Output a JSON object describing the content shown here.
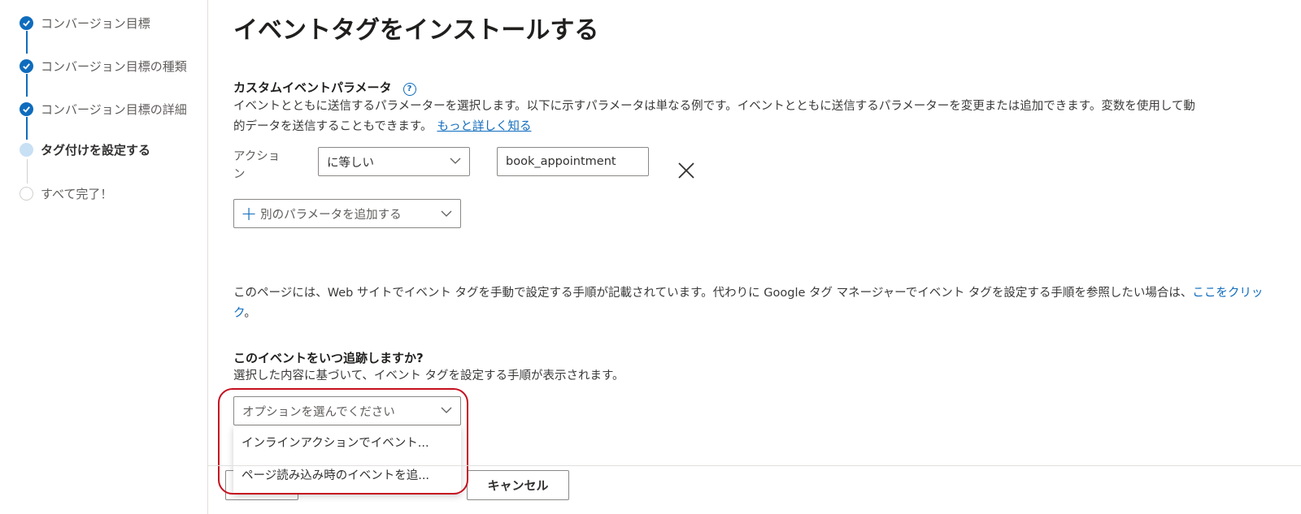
{
  "stepper": {
    "steps": [
      {
        "label": "コンバージョン目標",
        "state": "done"
      },
      {
        "label": "コンバージョン目標の種類",
        "state": "done"
      },
      {
        "label": "コンバージョン目標の詳細",
        "state": "done"
      },
      {
        "label": "タグ付けを設定する",
        "state": "current"
      },
      {
        "label": "すべて完了！",
        "state": "todo"
      }
    ]
  },
  "page": {
    "title": "イベントタグをインストールする"
  },
  "custom_params": {
    "title": "カスタムイベントパラメータ",
    "help_icon": "?",
    "desc_line1": "イベントとともに送信するパラメーターを選択します。以下に示すパラメータは単なる例です。イベントとともに送信するパラメーターを変更または追加できます。変数を使用して動",
    "desc_line2": "的データを送信することもできます。",
    "learn_more": "もっと詳しく知る",
    "row": {
      "label_line1": "アクショ",
      "label_line2": "ン",
      "operator": "に等しい",
      "value": "book_appointment"
    },
    "add_param_label": "別のパラメータを追加する"
  },
  "gtm_note": {
    "text": "このページには、Web サイトでイベント タグを手動で設定する手順が記載されています。代わりに Google タグ マネージャーでイベント タグを設定する手順を参照したい場合は、",
    "link": "ここをクリック",
    "suffix": "。"
  },
  "track_when": {
    "title": "このイベントをいつ追跡しますか?",
    "desc": "選択した内容に基づいて、イベント タグを設定する手順が表示されます。",
    "select_placeholder": "オプションを選んでください",
    "options": [
      "インラインアクションでイベント...",
      "ページ読み込み時のイベントを追..."
    ]
  },
  "footer": {
    "cancel_label": "キャンセル"
  },
  "colors": {
    "accent": "#0f6cbd",
    "highlight": "#c50f1f"
  }
}
